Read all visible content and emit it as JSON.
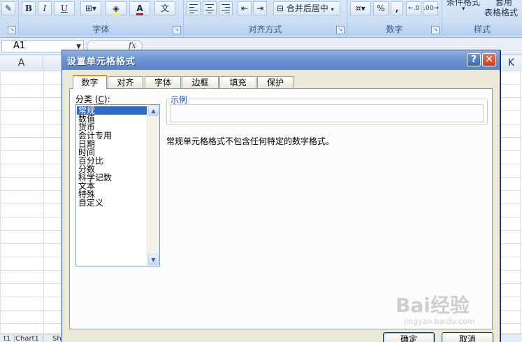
{
  "ribbon": {
    "groups": [
      {
        "label": "字体"
      },
      {
        "label": "对齐方式"
      },
      {
        "label": "数字"
      },
      {
        "label": "样式"
      }
    ],
    "bold": "B",
    "italic": "I",
    "underline": "U",
    "font_color_glyph": "A",
    "wen_glyph": "文",
    "merge_center_label": "合并后居中",
    "percent": "%",
    "comma": ",",
    "cond_format_label": "条件格式",
    "table_format_label": "套用",
    "table_format_label2": "表格格式"
  },
  "formula_bar": {
    "namebox": "A1",
    "fx": "fx"
  },
  "sheet": {
    "col_a": "A",
    "col_k": "K",
    "tabs": [
      "t1",
      "Chart1",
      "Sh"
    ]
  },
  "dialog": {
    "title": "设置单元格格式",
    "help": "?",
    "close": "✕",
    "tabs": [
      "数字",
      "对齐",
      "字体",
      "边框",
      "填充",
      "保护"
    ],
    "category_label_prefix": "分类 (",
    "category_label_key": "C",
    "category_label_suffix": "):",
    "categories": [
      "常规",
      "数值",
      "货币",
      "会计专用",
      "日期",
      "时间",
      "百分比",
      "分数",
      "科学记数",
      "文本",
      "特殊",
      "自定义"
    ],
    "example_legend": "示例",
    "description": "常规单元格格式不包含任何特定的数字格式。",
    "ok": "确定",
    "cancel": "取消"
  },
  "watermark": {
    "logo": "Bai经验",
    "url": "jingyan.baidu.com"
  }
}
